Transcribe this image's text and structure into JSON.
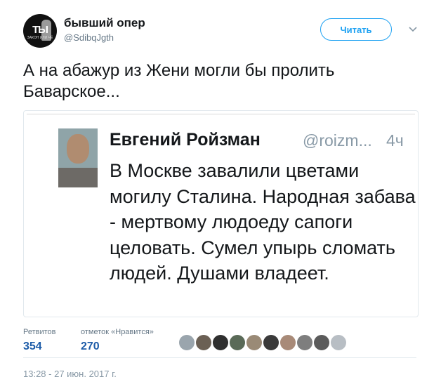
{
  "author": {
    "display_name": "бывший опер",
    "handle": "@SdibqJgth",
    "avatar_text": "ТЫ",
    "avatar_small_text": "ЗАКОН ИЛИ ЧЁ"
  },
  "follow_button": {
    "label": "Читать"
  },
  "tweet": {
    "text": "А на абажур из Жени могли бы пролить Баварское..."
  },
  "quoted_tweet": {
    "name": "Евгений Ройзман",
    "handle": "@roizm...",
    "time": "4ч",
    "body": "В Москве завалили цветами могилу Сталина. Народная забава - мертвому людоеду сапоги целовать. Сумел упырь сломать людей. Душами владеет."
  },
  "stats": {
    "retweets_label": "Ретвитов",
    "retweets_value": "354",
    "likes_label": "отметок «Нравится»",
    "likes_value": "270"
  },
  "likers": [
    {
      "name": "liker-avatar-1",
      "color": "#9aa5ad"
    },
    {
      "name": "liker-avatar-2",
      "color": "#6b6054"
    },
    {
      "name": "liker-avatar-3",
      "color": "#2f2f2f"
    },
    {
      "name": "liker-avatar-4",
      "color": "#5a6a58"
    },
    {
      "name": "liker-avatar-5",
      "color": "#9a8a76"
    },
    {
      "name": "liker-avatar-6",
      "color": "#3a3a3a"
    },
    {
      "name": "liker-avatar-7",
      "color": "#a88a78"
    },
    {
      "name": "liker-avatar-8",
      "color": "#7e7e7e"
    },
    {
      "name": "liker-avatar-9",
      "color": "#5b5b5b"
    },
    {
      "name": "liker-avatar-10",
      "color": "#b8bec4"
    }
  ],
  "timestamp": "13:28 - 27 июн. 2017 г.",
  "colors": {
    "accent": "#1da1f2",
    "text": "#14171a",
    "muted": "#657786",
    "stat_value": "#1d5ca8"
  }
}
